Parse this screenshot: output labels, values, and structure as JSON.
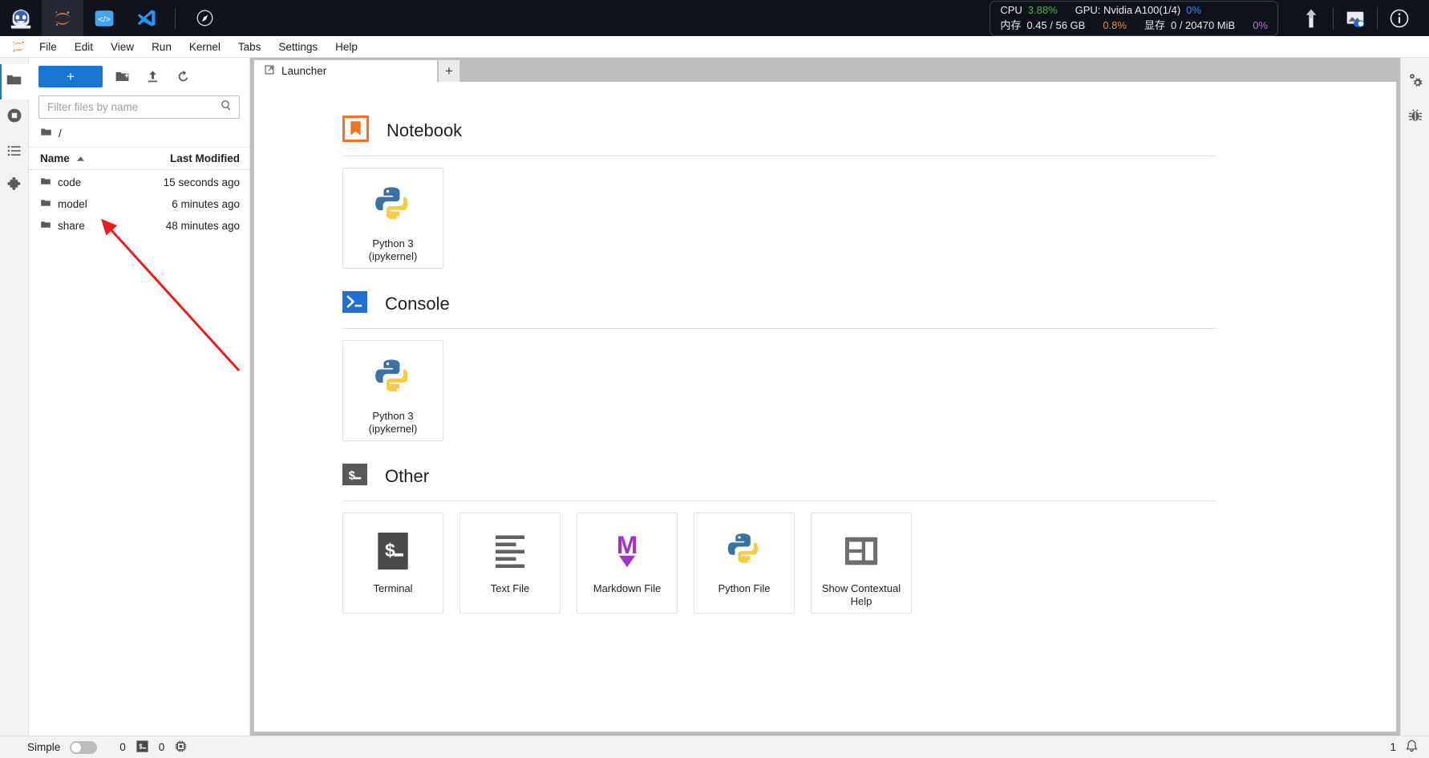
{
  "topbar": {
    "apps": [
      {
        "name": "robot-mascot-icon",
        "title": "AI Assistant"
      },
      {
        "name": "jupyter-icon",
        "title": "JupyterLab"
      },
      {
        "name": "code-server-icon",
        "title": "Code Server"
      },
      {
        "name": "vscode-icon",
        "title": "VS Code"
      },
      {
        "name": "compass-icon",
        "title": "Browser"
      }
    ],
    "resources": {
      "cpu_label": "CPU",
      "cpu_value": "3.88%",
      "gpu_label": "GPU: Nvidia A100(1/4)",
      "gpu_value": "0%",
      "mem_label": "内存",
      "mem_value": "0.45 / 56 GB",
      "mem_pct": "0.8%",
      "vram_label": "显存",
      "vram_value": "0 / 20470 MiB",
      "vram_pct": "0%"
    },
    "right_icons": [
      {
        "name": "upload-arrow-icon"
      },
      {
        "name": "image-toggle-icon"
      },
      {
        "name": "info-icon"
      }
    ]
  },
  "menubar": {
    "logo": "jupyter-logo-icon",
    "items": [
      {
        "label": "File"
      },
      {
        "label": "Edit"
      },
      {
        "label": "View"
      },
      {
        "label": "Run"
      },
      {
        "label": "Kernel"
      },
      {
        "label": "Tabs"
      },
      {
        "label": "Settings"
      },
      {
        "label": "Help"
      }
    ]
  },
  "left_rail": {
    "items": [
      {
        "name": "file-browser",
        "icon": "folder-icon",
        "active": true
      },
      {
        "name": "running-terminals",
        "icon": "running-icon",
        "active": false
      },
      {
        "name": "table-of-contents",
        "icon": "list-icon",
        "active": false
      },
      {
        "name": "extension-manager",
        "icon": "puzzle-icon",
        "active": false
      }
    ]
  },
  "right_rail": {
    "items": [
      {
        "name": "property-inspector",
        "icon": "gears-icon"
      },
      {
        "name": "debugger",
        "icon": "bug-icon"
      }
    ]
  },
  "filebrowser": {
    "new_button_label": "+",
    "toolbar_icons": [
      {
        "name": "new-folder-icon"
      },
      {
        "name": "upload-icon"
      },
      {
        "name": "refresh-icon"
      }
    ],
    "filter_placeholder": "Filter files by name",
    "filter_value": "",
    "search_icon": "search-icon",
    "breadcrumb": "/",
    "columns": {
      "name": "Name",
      "last_modified": "Last Modified"
    },
    "sort_direction": "asc",
    "rows": [
      {
        "name": "code",
        "modified": "15 seconds ago",
        "type": "folder"
      },
      {
        "name": "model",
        "modified": "6 minutes ago",
        "type": "folder"
      },
      {
        "name": "share",
        "modified": "48 minutes ago",
        "type": "folder"
      }
    ]
  },
  "dock": {
    "tabs": [
      {
        "label": "Launcher",
        "icon": "launcher-icon",
        "active": true
      }
    ],
    "add_tab_label": "+"
  },
  "launcher": {
    "sections": [
      {
        "title": "Notebook",
        "icon": "notebook-icon",
        "cards": [
          {
            "label": "Python 3\n(ipykernel)",
            "icon": "python-icon"
          }
        ]
      },
      {
        "title": "Console",
        "icon": "console-icon",
        "cards": [
          {
            "label": "Python 3\n(ipykernel)",
            "icon": "python-icon"
          }
        ]
      },
      {
        "title": "Other",
        "icon": "other-icon",
        "cards": [
          {
            "label": "Terminal",
            "icon": "terminal-icon"
          },
          {
            "label": "Text File",
            "icon": "textfile-icon"
          },
          {
            "label": "Markdown File",
            "icon": "markdown-icon"
          },
          {
            "label": "Python File",
            "icon": "python-icon"
          },
          {
            "label": "Show Contextual Help",
            "icon": "contextual-help-icon"
          }
        ]
      }
    ]
  },
  "statusbar": {
    "simple_label": "Simple",
    "simple_on": false,
    "kernel_count": "0",
    "terminal_icon": "terminal-icon",
    "terminal_count": "0",
    "cpu_icon": "chip-icon",
    "notification_count": "1",
    "bell_icon": "bell-icon"
  },
  "annotation": {
    "name": "red-arrow-pointing-to-code-folder",
    "color": "#ee1c1c"
  }
}
